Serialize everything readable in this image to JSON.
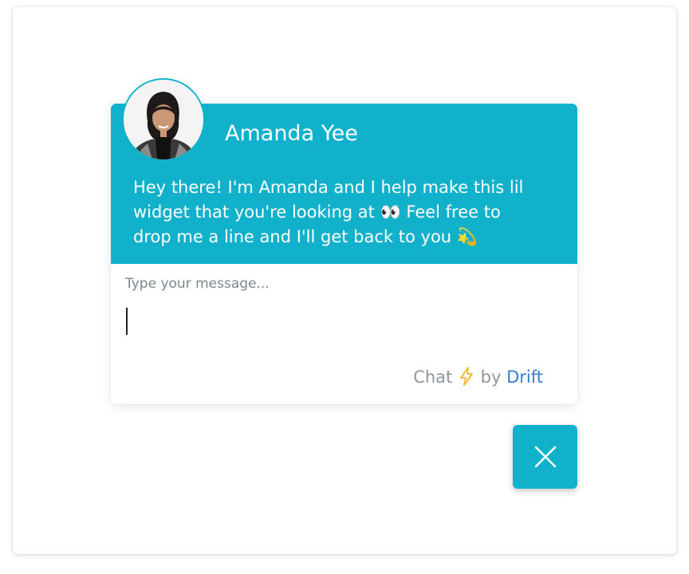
{
  "widget": {
    "agent_name": "Amanda Yee",
    "greeting_line1": "Hey there! I'm Amanda and I help make this lil",
    "greeting_line2": "widget that you're looking at 👀  Feel free to",
    "greeting_line3": "drop me a line and I'll get back to you 💫",
    "avatar_icon": "agent-photo-avatar"
  },
  "composer": {
    "placeholder": "Type your message...",
    "value": ""
  },
  "branding": {
    "chat_label": "Chat",
    "bolt_icon": "lightning-bolt-icon",
    "by_label": "by",
    "brand_link": "Drift"
  },
  "launcher": {
    "close_icon": "close-x-icon"
  },
  "colors": {
    "accent": "#11b1cc",
    "link": "#2d7fd6",
    "muted_text": "#8f969b",
    "bolt": "#f5b82e"
  }
}
